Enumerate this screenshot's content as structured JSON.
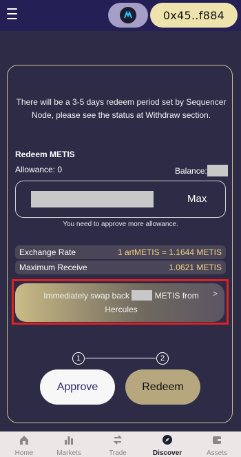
{
  "header": {
    "wallet_address": "0x45..f884",
    "network_icon": "metis-network-icon"
  },
  "notice": "There will be a 3-5 days redeem period set by Sequencer Node, please see the status at Withdraw section.",
  "redeem": {
    "title": "Redeem METIS",
    "allowance_label": "Allowance: 0",
    "balance_label": "Balance:",
    "amount_value": "",
    "max_label": "Max",
    "approve_hint": "You need to approve more allowance."
  },
  "rows": [
    {
      "label": "Exchange Rate",
      "value": "1 artMETIS = 1.1644 METIS"
    },
    {
      "label": "Maximum Receive",
      "value": "1.0621 METIS"
    }
  ],
  "swap": {
    "text_before": "Immediately swap back",
    "text_after": "METIS from Hercules",
    "arrow": ">"
  },
  "steps": [
    "1",
    "2"
  ],
  "buttons": {
    "approve": "Approve",
    "redeem": "Redeem"
  },
  "nav": [
    {
      "label": "Home",
      "icon": "home-icon",
      "active": false
    },
    {
      "label": "Markets",
      "icon": "bar-chart-icon",
      "active": false
    },
    {
      "label": "Trade",
      "icon": "swap-arrows-icon",
      "active": false
    },
    {
      "label": "Discover",
      "icon": "compass-icon",
      "active": true
    },
    {
      "label": "Assets",
      "icon": "wallet-icon",
      "active": false
    }
  ],
  "colors": {
    "background": "#2e2b47",
    "header": "#241f55",
    "accent_gold": "#f2d27f",
    "highlight_red": "#e02020"
  }
}
